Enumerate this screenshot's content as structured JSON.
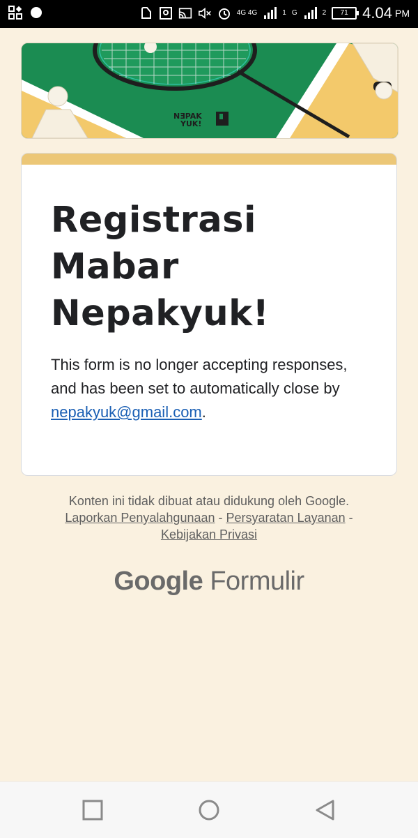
{
  "status_bar": {
    "time": "4.04",
    "ampm": "PM",
    "battery": "71",
    "network_1": "4G 4G",
    "network_2": "G",
    "sim_1": "1",
    "sim_2": "2",
    "icons": [
      "qr-scan-icon",
      "circle-dot-icon",
      "notification-icon",
      "image-icon",
      "cast-icon",
      "mute-icon",
      "alarm-icon",
      "signal-icon",
      "signal-icon",
      "battery-icon"
    ]
  },
  "banner": {
    "logo_line1": "NƎPAK",
    "logo_line2": "YUK!"
  },
  "form": {
    "title": "Registrasi Mabar Nepakyuk!",
    "description_text": "This form is no longer accepting responses, and has been set to automatically close by ",
    "email": "nepakyuk@gmail.com",
    "description_end": ".",
    "accent_color": "#ecc777"
  },
  "footer": {
    "disclaimer": "Konten ini tidak dibuat atau didukung oleh Google.",
    "link_abuse": "Laporkan Penyalahgunaan",
    "separator": "-",
    "link_terms": "Persyaratan Layanan",
    "link_privacy": "Kebijakan Privasi",
    "brand_google": "Google",
    "brand_forms": "Formulir"
  },
  "colors": {
    "page_bg": "#faf1e0",
    "banner_green": "#1b8c52",
    "banner_yellow": "#f3c96b",
    "link_blue": "#1a5fb4"
  }
}
